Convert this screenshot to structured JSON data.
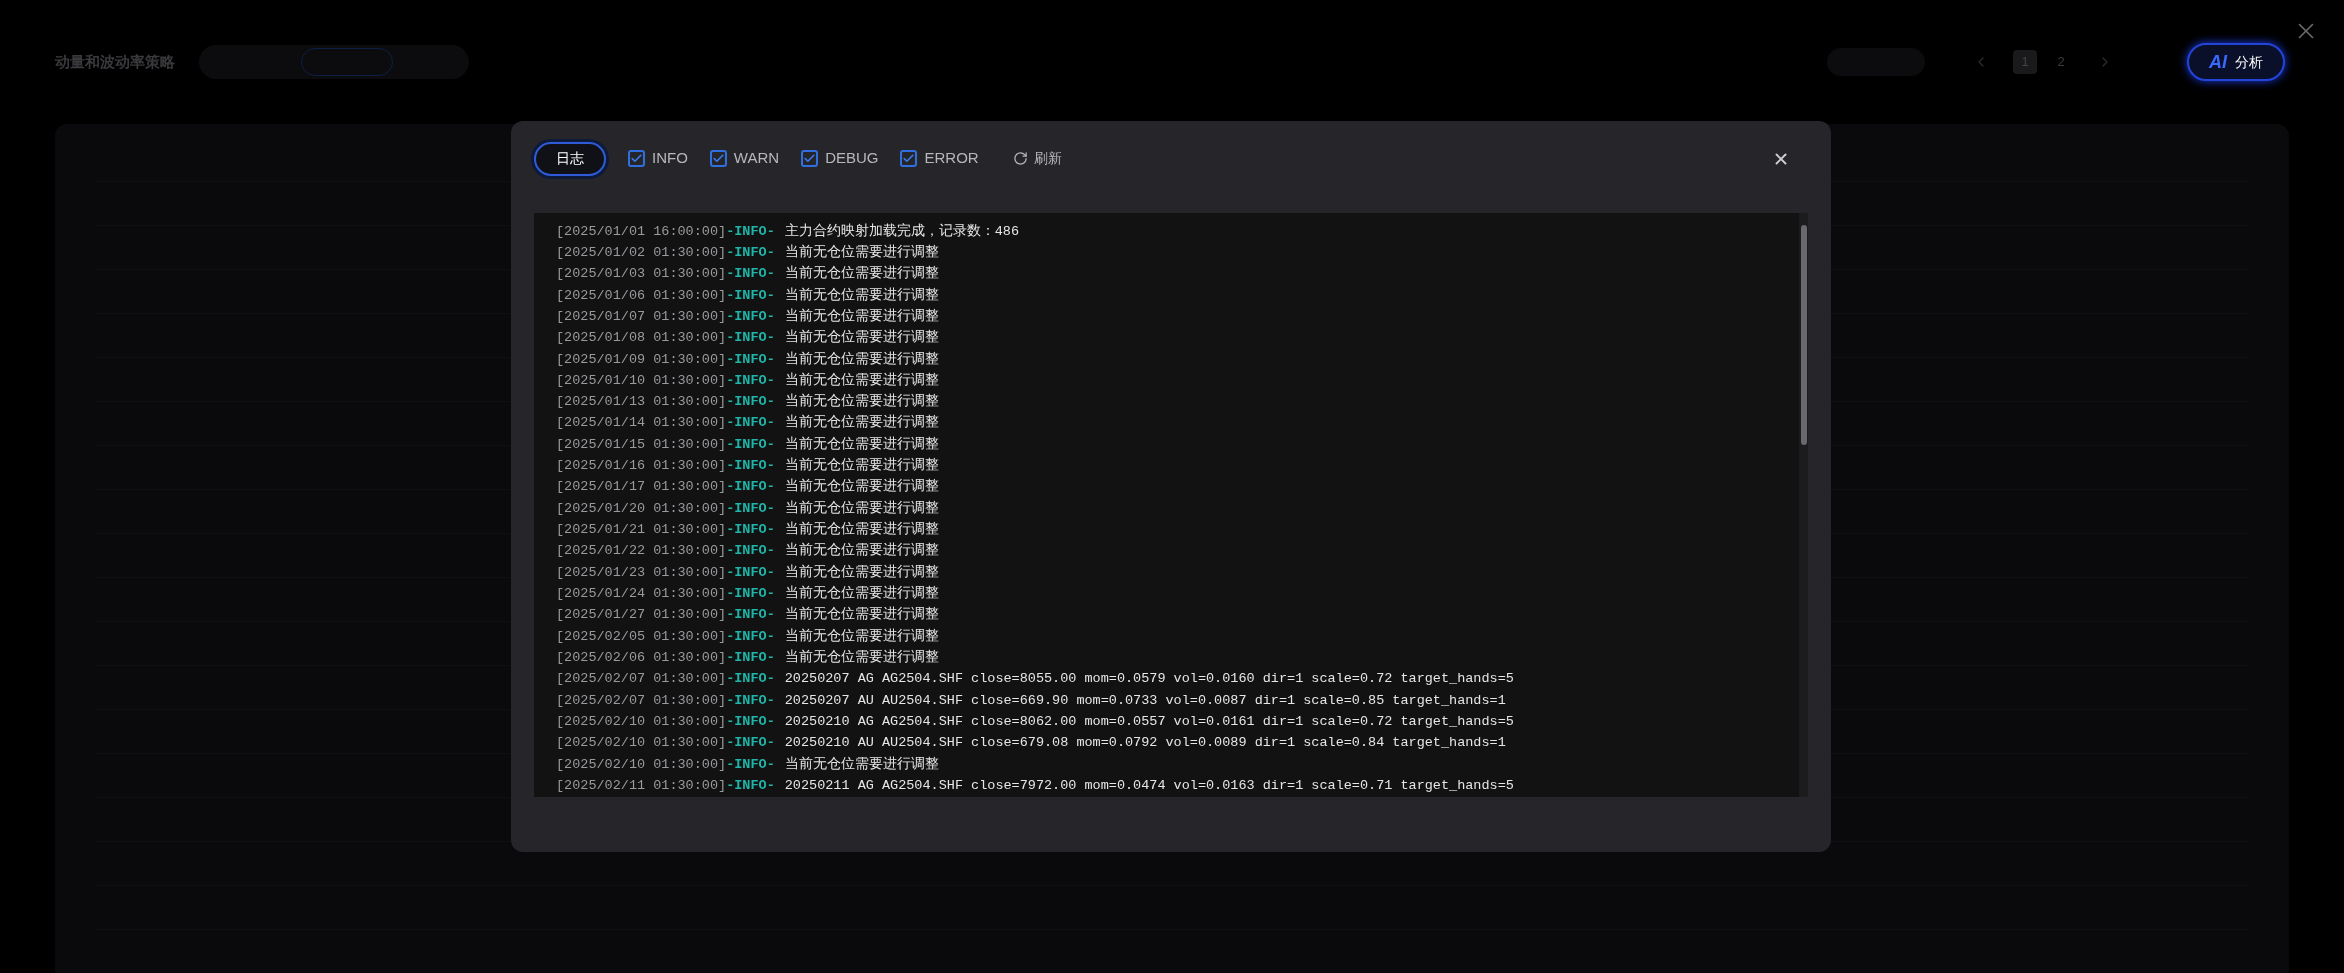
{
  "top_bar": {
    "title": "动量和波动率策略",
    "pages": [
      {
        "label": "1",
        "selected": true
      },
      {
        "label": "2",
        "selected": false
      }
    ],
    "ai_button": {
      "badge": "AI",
      "label": "分析"
    }
  },
  "log_dialog": {
    "tab": "日志",
    "filters": [
      {
        "label": "INFO",
        "checked": true
      },
      {
        "label": "WARN",
        "checked": true
      },
      {
        "label": "DEBUG",
        "checked": true
      },
      {
        "label": "ERROR",
        "checked": true
      }
    ],
    "refresh": "刷新",
    "lines": [
      {
        "time": "[2025/01/01 16:00:00]",
        "kind": "info",
        "tag": "-INFO-",
        "message": "主力合约映射加载完成，记录数：486"
      },
      {
        "time": "[2025/01/02 01:30:00]",
        "kind": "info",
        "tag": "-INFO-",
        "message": "当前无仓位需要进行调整"
      },
      {
        "time": "[2025/01/03 01:30:00]",
        "kind": "info",
        "tag": "-INFO-",
        "message": "当前无仓位需要进行调整"
      },
      {
        "time": "[2025/01/06 01:30:00]",
        "kind": "info",
        "tag": "-INFO-",
        "message": "当前无仓位需要进行调整"
      },
      {
        "time": "[2025/01/07 01:30:00]",
        "kind": "info",
        "tag": "-INFO-",
        "message": "当前无仓位需要进行调整"
      },
      {
        "time": "[2025/01/08 01:30:00]",
        "kind": "info",
        "tag": "-INFO-",
        "message": "当前无仓位需要进行调整"
      },
      {
        "time": "[2025/01/09 01:30:00]",
        "kind": "info",
        "tag": "-INFO-",
        "message": "当前无仓位需要进行调整"
      },
      {
        "time": "[2025/01/10 01:30:00]",
        "kind": "info",
        "tag": "-INFO-",
        "message": "当前无仓位需要进行调整"
      },
      {
        "time": "[2025/01/13 01:30:00]",
        "kind": "info",
        "tag": "-INFO-",
        "message": "当前无仓位需要进行调整"
      },
      {
        "time": "[2025/01/14 01:30:00]",
        "kind": "info",
        "tag": "-INFO-",
        "message": "当前无仓位需要进行调整"
      },
      {
        "time": "[2025/01/15 01:30:00]",
        "kind": "info",
        "tag": "-INFO-",
        "message": "当前无仓位需要进行调整"
      },
      {
        "time": "[2025/01/16 01:30:00]",
        "kind": "info",
        "tag": "-INFO-",
        "message": "当前无仓位需要进行调整"
      },
      {
        "time": "[2025/01/17 01:30:00]",
        "kind": "info",
        "tag": "-INFO-",
        "message": "当前无仓位需要进行调整"
      },
      {
        "time": "[2025/01/20 01:30:00]",
        "kind": "info",
        "tag": "-INFO-",
        "message": "当前无仓位需要进行调整"
      },
      {
        "time": "[2025/01/21 01:30:00]",
        "kind": "info",
        "tag": "-INFO-",
        "message": "当前无仓位需要进行调整"
      },
      {
        "time": "[2025/01/22 01:30:00]",
        "kind": "info",
        "tag": "-INFO-",
        "message": "当前无仓位需要进行调整"
      },
      {
        "time": "[2025/01/23 01:30:00]",
        "kind": "info",
        "tag": "-INFO-",
        "message": "当前无仓位需要进行调整"
      },
      {
        "time": "[2025/01/24 01:30:00]",
        "kind": "info",
        "tag": "-INFO-",
        "message": "当前无仓位需要进行调整"
      },
      {
        "time": "[2025/01/27 01:30:00]",
        "kind": "info",
        "tag": "-INFO-",
        "message": "当前无仓位需要进行调整"
      },
      {
        "time": "[2025/02/05 01:30:00]",
        "kind": "info",
        "tag": "-INFO-",
        "message": "当前无仓位需要进行调整"
      },
      {
        "time": "[2025/02/06 01:30:00]",
        "kind": "info",
        "tag": "-INFO-",
        "message": "当前无仓位需要进行调整"
      },
      {
        "time": "[2025/02/07 01:30:00]",
        "kind": "info",
        "tag": "-INFO-",
        "message": "20250207 AG AG2504.SHF close=8055.00 mom=0.0579 vol=0.0160 dir=1 scale=0.72 target_hands=5"
      },
      {
        "time": "[2025/02/07 01:30:00]",
        "kind": "info",
        "tag": "-INFO-",
        "message": "20250207 AU AU2504.SHF close=669.90 mom=0.0733 vol=0.0087 dir=1 scale=0.85 target_hands=1"
      },
      {
        "time": "[2025/02/10 01:30:00]",
        "kind": "info",
        "tag": "-INFO-",
        "message": "20250210 AG AG2504.SHF close=8062.00 mom=0.0557 vol=0.0161 dir=1 scale=0.72 target_hands=5"
      },
      {
        "time": "[2025/02/10 01:30:00]",
        "kind": "info",
        "tag": "-INFO-",
        "message": "20250210 AU AU2504.SHF close=679.08 mom=0.0792 vol=0.0089 dir=1 scale=0.84 target_hands=1"
      },
      {
        "time": "[2025/02/10 01:30:00]",
        "kind": "info",
        "tag": "-INFO-",
        "message": "当前无仓位需要进行调整"
      },
      {
        "time": "[2025/02/11 01:30:00]",
        "kind": "info",
        "tag": "-INFO-",
        "message": "20250211 AG AG2504.SHF close=7972.00 mom=0.0474 vol=0.0163 dir=1 scale=0.71 target_hands=5"
      }
    ]
  }
}
